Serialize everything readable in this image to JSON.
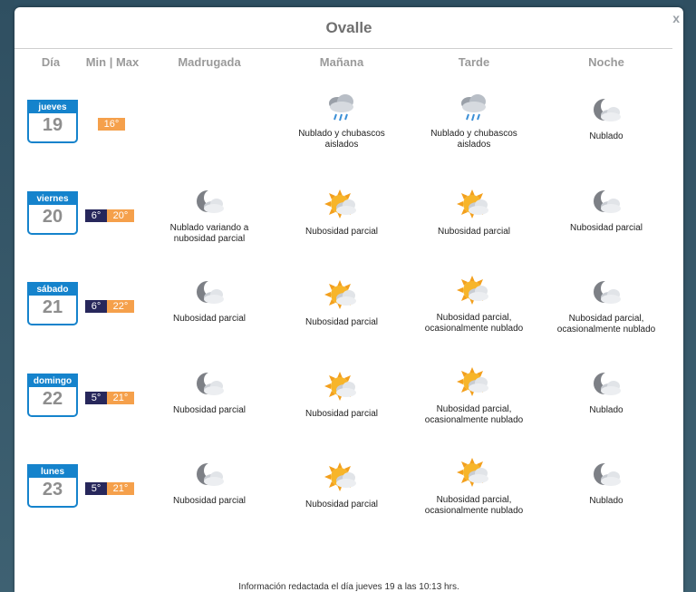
{
  "window": {
    "close_label": "x",
    "title": "Ovalle"
  },
  "headers": [
    "Día",
    "Min | Max",
    "Madrugada",
    "Mañana",
    "Tarde",
    "Noche"
  ],
  "rows": [
    {
      "day": "jueves",
      "date": "19",
      "min": "",
      "max": "16°",
      "cells": [
        {
          "icon": "",
          "text": []
        },
        {
          "icon": "rain",
          "text": [
            "Nublado y chubascos",
            "aislados"
          ]
        },
        {
          "icon": "rain",
          "text": [
            "Nublado y chubascos",
            "aislados"
          ]
        },
        {
          "icon": "moon-cloud",
          "text": [
            "Nublado"
          ]
        }
      ]
    },
    {
      "day": "viernes",
      "date": "20",
      "min": "6°",
      "max": "20°",
      "cells": [
        {
          "icon": "moon-cloud",
          "text": [
            "Nublado variando a",
            "nubosidad parcial"
          ]
        },
        {
          "icon": "sun-cloud",
          "text": [
            "Nubosidad parcial"
          ]
        },
        {
          "icon": "sun-cloud",
          "text": [
            "Nubosidad parcial"
          ]
        },
        {
          "icon": "moon-cloud",
          "text": [
            "Nubosidad parcial"
          ]
        }
      ]
    },
    {
      "day": "sábado",
      "date": "21",
      "min": "6°",
      "max": "22°",
      "cells": [
        {
          "icon": "moon-cloud",
          "text": [
            "Nubosidad parcial"
          ]
        },
        {
          "icon": "sun-cloud",
          "text": [
            "Nubosidad parcial"
          ]
        },
        {
          "icon": "sun-cloud",
          "text": [
            "Nubosidad parcial,",
            "ocasionalmente nublado"
          ]
        },
        {
          "icon": "moon-cloud",
          "text": [
            "Nubosidad parcial,",
            "ocasionalmente nublado"
          ]
        }
      ]
    },
    {
      "day": "domingo",
      "date": "22",
      "min": "5°",
      "max": "21°",
      "cells": [
        {
          "icon": "moon-cloud",
          "text": [
            "Nubosidad parcial"
          ]
        },
        {
          "icon": "sun-cloud",
          "text": [
            "Nubosidad parcial"
          ]
        },
        {
          "icon": "sun-cloud",
          "text": [
            "Nubosidad parcial,",
            "ocasionalmente nublado"
          ]
        },
        {
          "icon": "moon-cloud",
          "text": [
            "Nublado"
          ]
        }
      ]
    },
    {
      "day": "lunes",
      "date": "23",
      "min": "5°",
      "max": "21°",
      "cells": [
        {
          "icon": "moon-cloud",
          "text": [
            "Nubosidad parcial"
          ]
        },
        {
          "icon": "sun-cloud",
          "text": [
            "Nubosidad parcial"
          ]
        },
        {
          "icon": "sun-cloud",
          "text": [
            "Nubosidad parcial,",
            "ocasionalmente nublado"
          ]
        },
        {
          "icon": "moon-cloud",
          "text": [
            "Nublado"
          ]
        }
      ]
    }
  ],
  "footer": "Información redactada el día jueves 19 a las 10:13 hrs.",
  "colors": {
    "accent": "#1583cc",
    "min_bg": "#27275b",
    "max_bg": "#f5a04b"
  }
}
